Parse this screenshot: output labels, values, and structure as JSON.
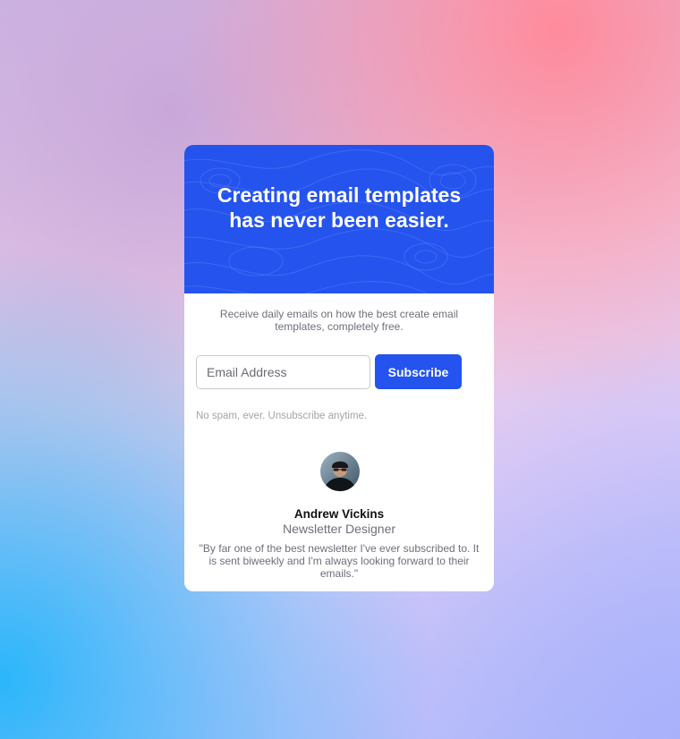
{
  "hero": {
    "title": "Creating email templates has never been easier."
  },
  "intro": {
    "text": "Receive daily emails on how the best create email templates, completely free."
  },
  "form": {
    "email_placeholder": "Email Address",
    "email_value": "",
    "subscribe_label": "Subscribe"
  },
  "disclaimer": "No spam, ever. Unsubscribe anytime.",
  "testimonial": {
    "name": "Andrew Vickins",
    "role": "Newsletter Designer",
    "quote": "\"By far one of the best newsletter I've ever subscribed to. It is sent biweekly and I'm always looking forward to their emails.\""
  },
  "colors": {
    "accent": "#2453ee",
    "card_background": "#ffffff",
    "muted_text": "#6f6f7b"
  }
}
